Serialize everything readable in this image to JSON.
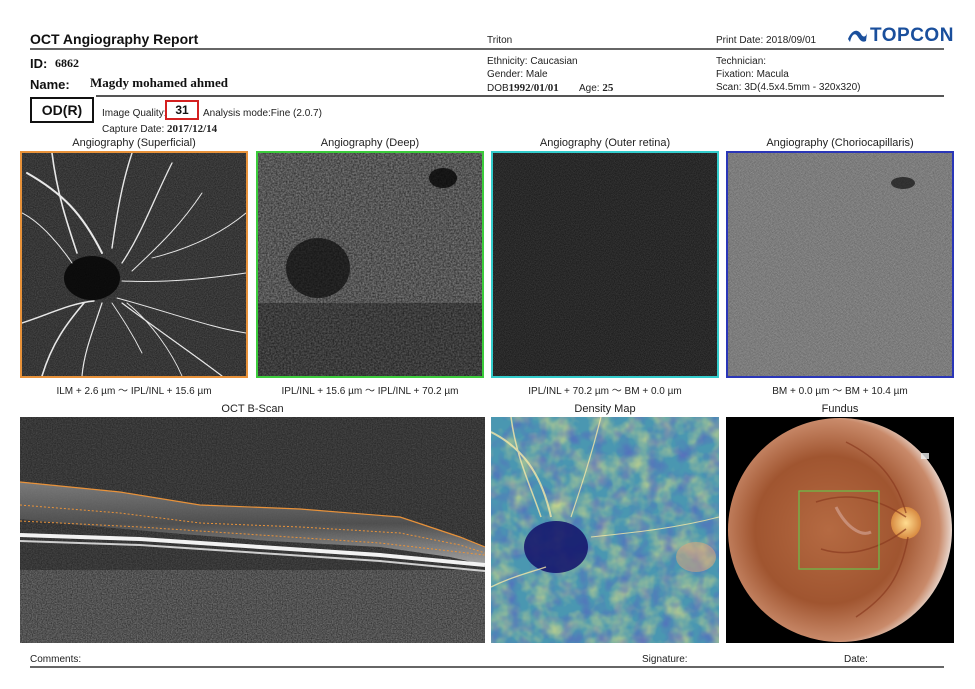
{
  "header": {
    "title": "OCT Angiography Report",
    "device": "Triton",
    "print_date": "Print Date: 2018/09/01",
    "brand": "TOPCON",
    "brand_color": "#1a4f9c"
  },
  "patient": {
    "id_label": "ID:",
    "id_value": "6862",
    "name_label": "Name:",
    "name_value": "Magdy mohamed ahmed",
    "ethnicity": "Ethnicity: Caucasian",
    "gender": "Gender: Male",
    "dob_label": "DOB",
    "dob_value": "1992/01/01",
    "age_label": "Age:",
    "age_value": "25",
    "technician": "Technician:",
    "fixation": "Fixation: Macula",
    "scan": "Scan: 3D(4.5x4.5mm - 320x320)"
  },
  "exam": {
    "eye": "OD(R)",
    "quality_label": "Image Quality:",
    "quality_value": "31",
    "analysis_label": "Analysis mode:Fine (2.0.7)",
    "capture_label": "Capture Date:",
    "capture_value": "2017/12/14"
  },
  "panels": [
    {
      "title": "Angiography (Superficial)",
      "range": "ILM + 2.6 µm ～ IPL/INL + 15.6 µm",
      "border": "#e8923a"
    },
    {
      "title": "Angiography (Deep)",
      "range": "IPL/INL + 15.6 µm ～ IPL/INL + 70.2 µm",
      "border": "#3ccc3c"
    },
    {
      "title": "Angiography (Outer retina)",
      "range": "IPL/INL + 70.2 µm ～ BM + 0.0 µm",
      "border": "#33cccc"
    },
    {
      "title": "Angiography (Choriocapillaris)",
      "range": "BM + 0.0 µm ～ BM + 10.4 µm",
      "border": "#2a36b8"
    }
  ],
  "lower": {
    "bscan_title": "OCT B-Scan",
    "density_title": "Density Map",
    "fundus_title": "Fundus"
  },
  "footer": {
    "comments": "Comments:",
    "signature": "Signature:",
    "date": "Date:"
  }
}
